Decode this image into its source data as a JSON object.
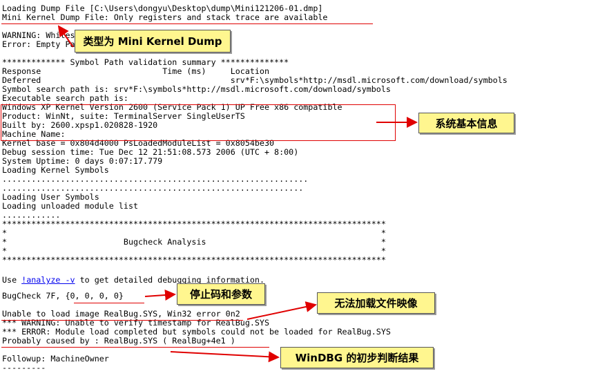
{
  "lines": [
    "Loading Dump File [C:\\Users\\dongyu\\Desktop\\dump\\Mini121206-01.dmp]",
    "Mini Kernel Dump File: Only registers and stack trace are available",
    "",
    "WARNING: Whitespace at end of path element",
    "Error: Empty Path.",
    "",
    "************* Symbol Path validation summary **************",
    "Response                         Time (ms)     Location",
    "Deferred                                       srv*F:\\symbols*http://msdl.microsoft.com/download/symbols",
    "Symbol search path is: srv*F:\\symbols*http://msdl.microsoft.com/download/symbols",
    "Executable search path is:",
    "Windows XP Kernel Version 2600 (Service Pack 1) UP Free x86 compatible",
    "Product: WinNt, suite: TerminalServer SingleUserTS",
    "Built by: 2600.xpsp1.020828-1920",
    "Machine Name:",
    "Kernel base = 0x804d4000 PsLoadedModuleList = 0x8054be30",
    "Debug session time: Tue Dec 12 21:51:08.573 2006 (UTC + 8:00)",
    "System Uptime: 0 days 0:07:17.779",
    "Loading Kernel Symbols",
    "...............................................................",
    "..............................................................",
    "Loading User Symbols",
    "Loading unloaded module list",
    "............",
    "*******************************************************************************",
    "*                                                                             *",
    "*                        Bugcheck Analysis                                    *",
    "*                                                                             *",
    "*******************************************************************************",
    "",
    "",
    "BugCheck 7F, {0, 0, 0, 0}",
    "",
    "Unable to load image RealBug.SYS, Win32 error 0n2",
    "*** WARNING: Unable to verify timestamp for RealBug.SYS",
    "*** ERROR: Module load completed but symbols could not be loaded for RealBug.SYS",
    "Probably caused by : RealBug.SYS ( RealBug+4e1 )",
    "",
    "Followup: MachineOwner",
    "---------"
  ],
  "analyze_line": {
    "prefix": "Use ",
    "link": "!analyze -v",
    "suffix": " to get detailed debugging information."
  },
  "callouts": {
    "dump_type": "类型为 Mini Kernel Dump",
    "system_info": "系统基本信息",
    "bugcheck": "停止码和参数",
    "image_load": "无法加载文件映像",
    "result": "WinDBG 的初步判断结果"
  },
  "colors": {
    "annotation_red": "#e00000",
    "callout_fill": "#fff68f",
    "link_blue": "#0000ee"
  }
}
